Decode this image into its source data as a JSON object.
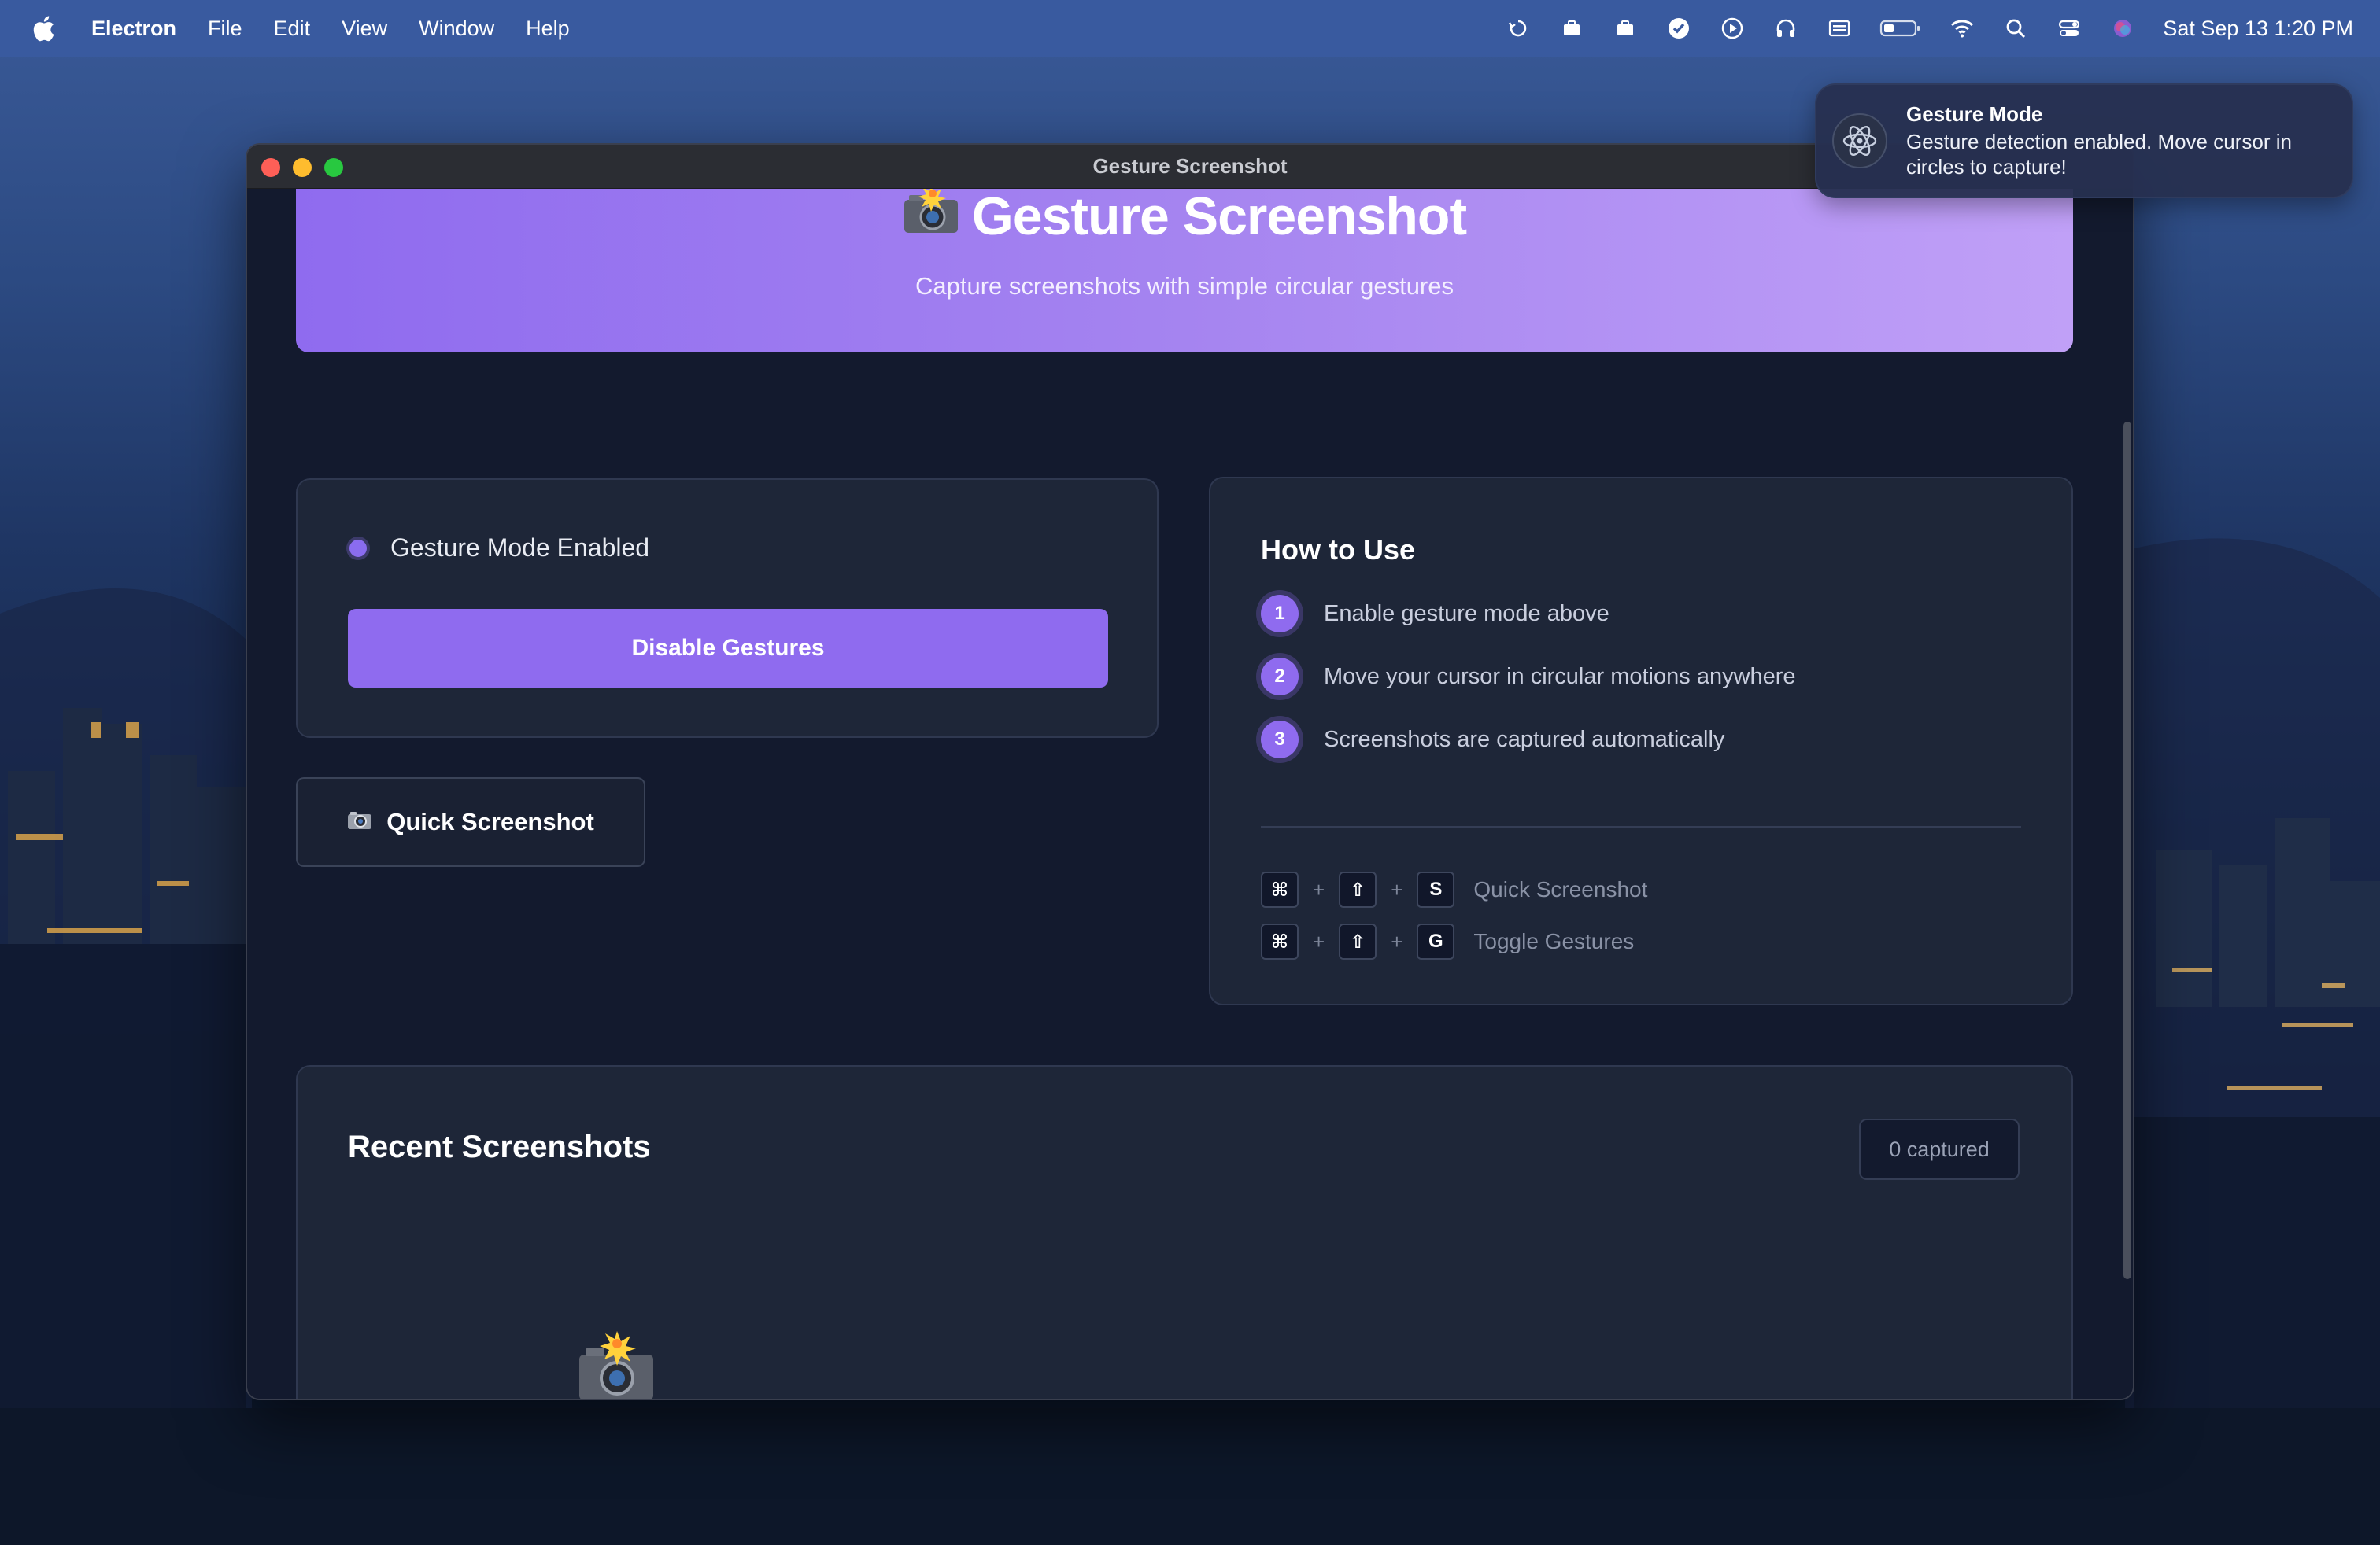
{
  "menubar": {
    "app_name": "Electron",
    "menus": [
      "File",
      "Edit",
      "View",
      "Window",
      "Help"
    ],
    "status_icons": [
      "sync-icon",
      "briefcase-icon",
      "briefcase-icon",
      "checkmark-circle-icon",
      "play-icon",
      "headphones-icon",
      "keyboard-icon",
      "battery-icon",
      "wifi-icon",
      "search-icon",
      "control-center-icon",
      "siri-icon"
    ],
    "clock": "Sat Sep 13  1:20 PM"
  },
  "window": {
    "title": "Gesture Screenshot"
  },
  "hero": {
    "title": "Gesture Screenshot",
    "subtitle": "Capture screenshots with simple circular gestures"
  },
  "gesture_panel": {
    "status_label": "Gesture Mode Enabled",
    "toggle_button": "Disable Gestures"
  },
  "quick_button": {
    "label": "Quick Screenshot"
  },
  "howto": {
    "title": "How to Use",
    "steps": [
      {
        "num": "1",
        "text": "Enable gesture mode above"
      },
      {
        "num": "2",
        "text": "Move your cursor in circular motions anywhere"
      },
      {
        "num": "3",
        "text": "Screenshots are captured automatically"
      }
    ],
    "shortcuts": [
      {
        "keys": [
          "⌘",
          "⇧",
          "S"
        ],
        "plus": "+",
        "label": "Quick Screenshot"
      },
      {
        "keys": [
          "⌘",
          "⇧",
          "G"
        ],
        "plus": "+",
        "label": "Toggle Gestures"
      }
    ]
  },
  "recent": {
    "title": "Recent Screenshots",
    "count": "0 captured"
  },
  "notification": {
    "title": "Gesture Mode",
    "body": "Gesture detection enabled. Move cursor in circles to capture!"
  },
  "colors": {
    "accent": "#8f6bef",
    "hero_gradient_start": "#8f6bef",
    "hero_gradient_end": "#c0a0f7",
    "window_bg": "#131a2e",
    "card_bg": "#1e2638"
  }
}
